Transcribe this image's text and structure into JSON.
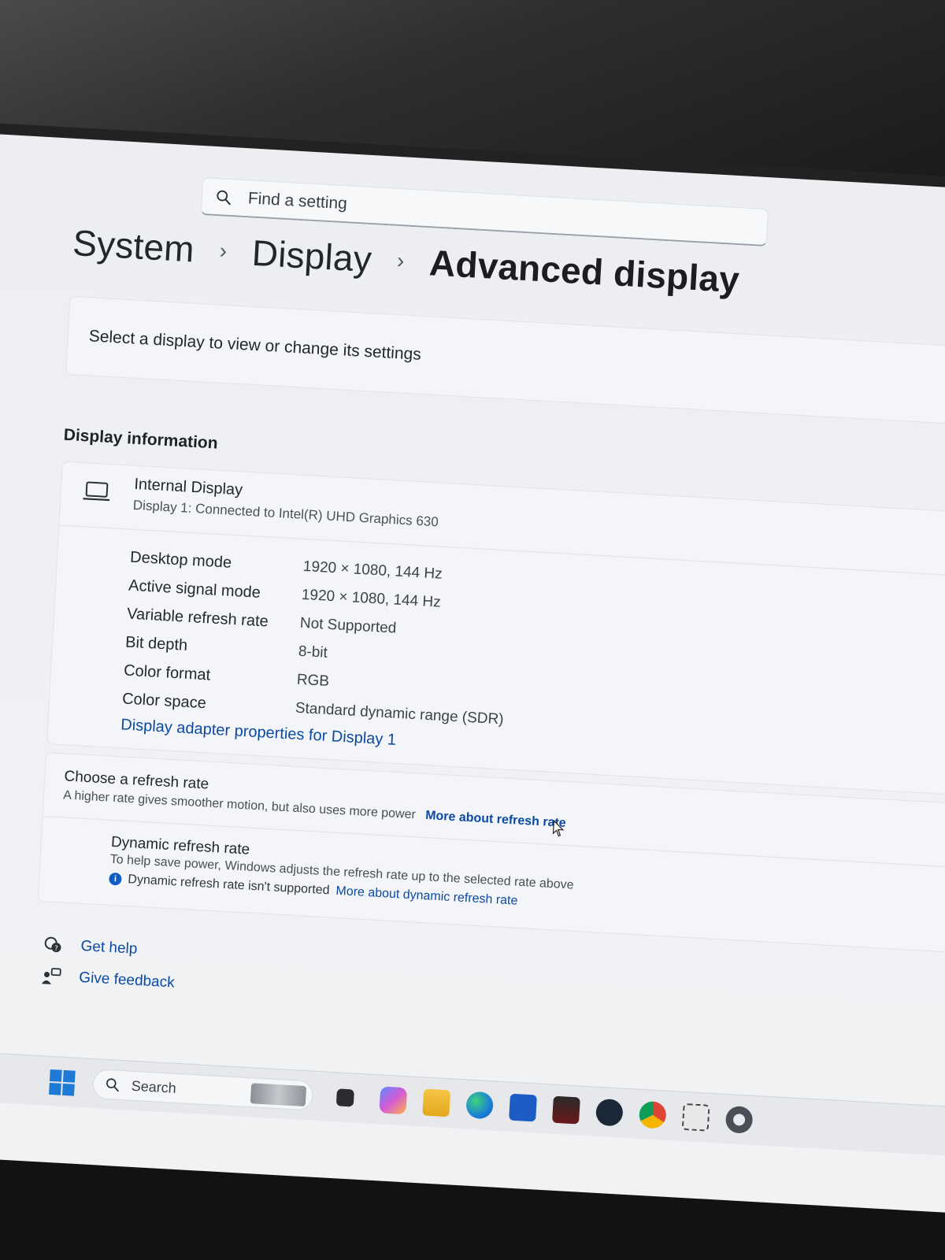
{
  "search": {
    "placeholder": "Find a setting"
  },
  "breadcrumb": {
    "level1": "System",
    "level2": "Display",
    "current": "Advanced display",
    "separator": "›"
  },
  "select_display": {
    "label": "Select a display to view or change its settings"
  },
  "display_info": {
    "section_title": "Display information",
    "display_name": "Internal Display",
    "display_subtitle": "Display 1: Connected to Intel(R) UHD Graphics 630",
    "properties": [
      {
        "label": "Desktop mode",
        "value": "1920 × 1080, 144 Hz"
      },
      {
        "label": "Active signal mode",
        "value": "1920 × 1080, 144 Hz"
      },
      {
        "label": "Variable refresh rate",
        "value": "Not Supported"
      },
      {
        "label": "Bit depth",
        "value": "8-bit"
      },
      {
        "label": "Color format",
        "value": "RGB"
      },
      {
        "label": "Color space",
        "value": "Standard dynamic range (SDR)"
      }
    ],
    "adapter_link": "Display adapter properties for Display 1"
  },
  "refresh": {
    "title": "Choose a refresh rate",
    "description": "A higher rate gives smoother motion, but also uses more power",
    "more_link": "More about refresh rate",
    "dynamic_title": "Dynamic refresh rate",
    "dynamic_description": "To help save power, Windows adjusts the refresh rate up to the selected rate above",
    "dynamic_note": "Dynamic refresh rate isn't supported",
    "dynamic_more_link": "More about dynamic refresh rate",
    "info_glyph": "i"
  },
  "help": {
    "get_help": "Get help",
    "give_feedback": "Give feedback"
  },
  "taskbar": {
    "search_label": "Search",
    "icons": [
      "start-icon",
      "task-view-icon",
      "copilot-icon",
      "file-explorer-icon",
      "edge-icon",
      "store-icon",
      "game-app-icon",
      "steam-icon",
      "chrome-icon",
      "snipping-tool-icon",
      "settings-icon"
    ]
  },
  "colors": {
    "accent": "#0b4aa2",
    "card": "#f4f5f8",
    "background": "#eceef2"
  }
}
